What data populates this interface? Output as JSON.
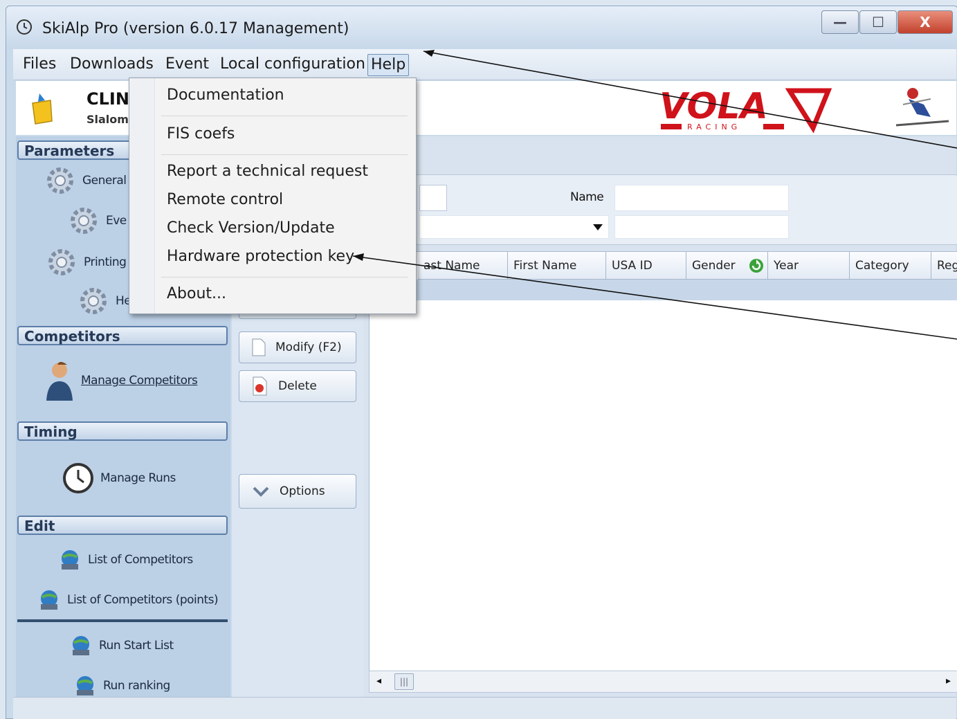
{
  "window": {
    "title": "SkiAlp Pro (version 6.0.17 Management)",
    "minimize": "—",
    "maximize": "☐",
    "close": "X"
  },
  "menubar": {
    "items": [
      "Files",
      "Downloads",
      "Event",
      "Local configuration",
      "Help"
    ]
  },
  "help_menu": {
    "items": [
      "Documentation",
      "FIS coefs",
      "Report a technical request",
      "Remote control",
      "Check Version/Update",
      "Hardware protection key",
      "About..."
    ]
  },
  "header": {
    "event_name": "CLIN",
    "event_sub": "Slalom",
    "logo_text": "VOLA",
    "logo_sub": "RACING"
  },
  "sidebar": {
    "parameters": {
      "title": "Parameters",
      "items": [
        "General",
        "Eve",
        "Printing",
        "He"
      ]
    },
    "competitors": {
      "title": "Competitors",
      "items": [
        "Manage Competitors"
      ]
    },
    "timing": {
      "title": "Timing",
      "items": [
        "Manage Runs"
      ]
    },
    "edit": {
      "title": "Edit",
      "items": [
        "List of Competitors",
        "List of Competitors (points)",
        "Run Start List",
        "Run ranking"
      ]
    }
  },
  "commands": {
    "modify": "Modify (F2)",
    "delete": "Delete",
    "options": "Options"
  },
  "filter": {
    "name_label": "Name"
  },
  "grid": {
    "columns": [
      "ast Name",
      "First Name",
      "USA ID",
      "Gender",
      "Year",
      "Category",
      "Regi"
    ]
  },
  "colors": {
    "window_bg": "#c9daea",
    "sidebar_bg": "#bcd0e6",
    "brand_red": "#d0121b",
    "menu_highlight": "#d6e4f4"
  }
}
